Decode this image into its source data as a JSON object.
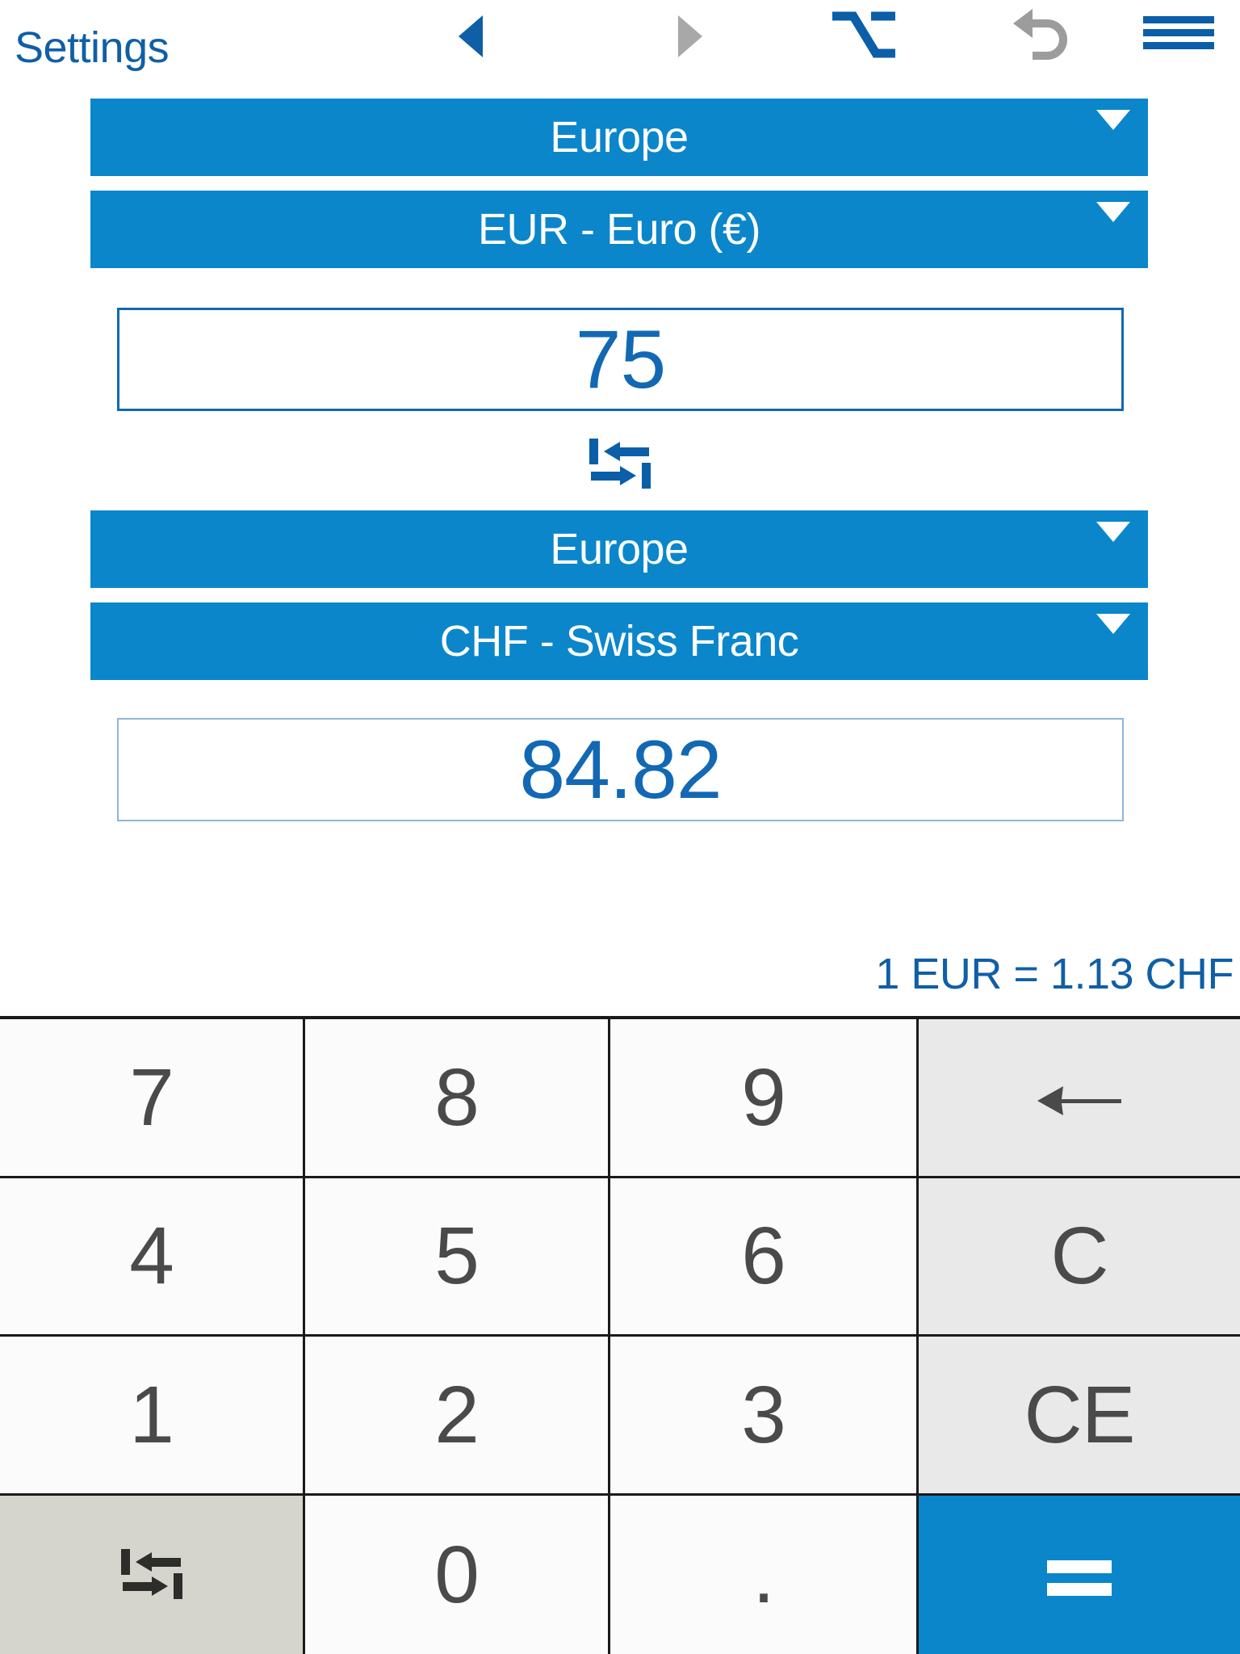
{
  "app": {
    "accent_blue": "#0b86cb",
    "text_blue": "#0f5fa6",
    "value_blue": "#1268b3",
    "key_text": "#4a4a4a"
  },
  "toolbar": {
    "settings_label": "Settings",
    "prev_icon": "triangle-left-icon",
    "next_icon": "triangle-right-icon",
    "alt_icon": "option-alt-key-icon",
    "undo_icon": "undo-arrow-icon",
    "menu_icon": "hamburger-menu-icon"
  },
  "converter": {
    "from": {
      "region": "Europe",
      "currency": "EUR - Euro (€)",
      "amount": "75"
    },
    "to": {
      "region": "Europe",
      "currency": "CHF - Swiss Franc",
      "amount": "84.82"
    },
    "swap_icon": "swap-arrows-icon",
    "caret_icon": "chevron-down-icon",
    "rate_text": "1 EUR = 1.13 CHF"
  },
  "keypad": {
    "rows": [
      [
        {
          "label": "7",
          "name": "key-7",
          "style": "digit"
        },
        {
          "label": "8",
          "name": "key-8",
          "style": "digit"
        },
        {
          "label": "9",
          "name": "key-9",
          "style": "digit"
        },
        {
          "label": "←",
          "name": "key-backspace",
          "style": "func",
          "icon": "backspace-arrow-icon"
        }
      ],
      [
        {
          "label": "4",
          "name": "key-4",
          "style": "digit"
        },
        {
          "label": "5",
          "name": "key-5",
          "style": "digit"
        },
        {
          "label": "6",
          "name": "key-6",
          "style": "digit"
        },
        {
          "label": "C",
          "name": "key-clear",
          "style": "func"
        }
      ],
      [
        {
          "label": "1",
          "name": "key-1",
          "style": "digit"
        },
        {
          "label": "2",
          "name": "key-2",
          "style": "digit"
        },
        {
          "label": "3",
          "name": "key-3",
          "style": "digit"
        },
        {
          "label": "CE",
          "name": "key-clear-entry",
          "style": "func"
        }
      ],
      [
        {
          "label": "",
          "name": "key-swap",
          "style": "swap",
          "icon": "swap-arrows-icon"
        },
        {
          "label": "0",
          "name": "key-0",
          "style": "digit"
        },
        {
          "label": ".",
          "name": "key-decimal",
          "style": "dot"
        },
        {
          "label": "=",
          "name": "key-equals",
          "style": "equals",
          "icon": "equals-icon"
        }
      ]
    ]
  }
}
